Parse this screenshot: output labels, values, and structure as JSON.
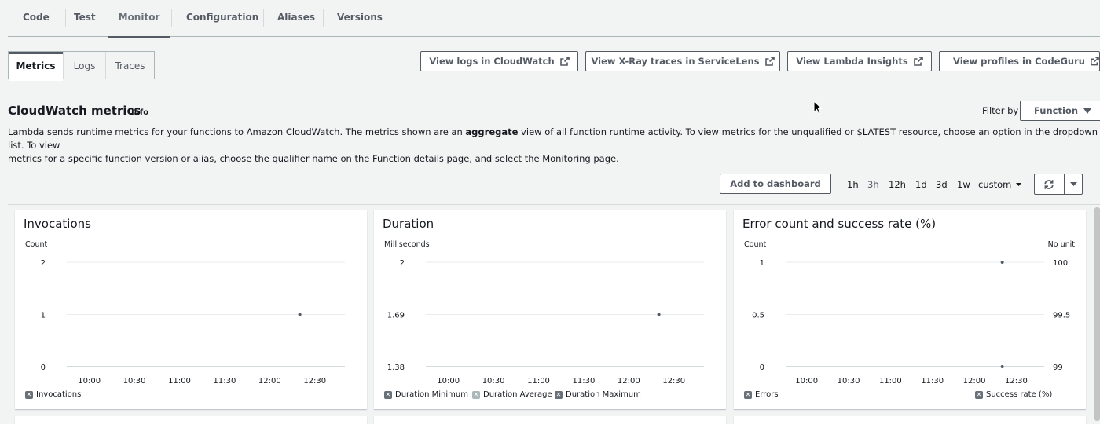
{
  "top_tabs": [
    "Code",
    "Test",
    "Monitor",
    "Configuration",
    "Aliases",
    "Versions"
  ],
  "active_top_tab": "Monitor",
  "sub_tabs": [
    "Metrics",
    "Logs",
    "Traces"
  ],
  "active_sub_tab": "Metrics",
  "action_buttons": [
    "View logs in CloudWatch",
    "View X-Ray traces in ServiceLens",
    "View Lambda Insights",
    "View profiles in CodeGuru"
  ],
  "section": {
    "title": "CloudWatch metrics",
    "info": "Info",
    "description_part1": "Lambda sends runtime metrics for your functions to Amazon CloudWatch. The metrics shown are an ",
    "description_bold": "aggregate",
    "description_part2": " view of all function runtime activity. To view metrics for the unqualified or $LATEST resource, choose an option in the dropdown list. To view",
    "description_line2": "metrics for a specific function version or alias, choose the qualifier name on the Function details page, and select the Monitoring page."
  },
  "filter": {
    "label": "Filter by",
    "value": "Function"
  },
  "toolbar": {
    "add_dashboard": "Add to dashboard",
    "time_ranges": [
      "1h",
      "3h",
      "12h",
      "1d",
      "3d",
      "1w"
    ],
    "active_time_range": "3h",
    "custom": "custom"
  },
  "chart_data": [
    {
      "type": "scatter",
      "title": "Invocations",
      "ylabel": "Count",
      "yticks": [
        "2",
        "1",
        "0"
      ],
      "ylim": [
        0,
        2
      ],
      "xticks": [
        "10:00",
        "10:30",
        "11:00",
        "11:30",
        "12:00",
        "12:30"
      ],
      "series": [
        {
          "name": "Invocations",
          "x": [
            "12:20"
          ],
          "y": [
            1
          ]
        }
      ]
    },
    {
      "type": "scatter",
      "title": "Duration",
      "ylabel": "Milliseconds",
      "yticks": [
        "2",
        "1.69",
        "1.38"
      ],
      "ylim": [
        1.38,
        2
      ],
      "xticks": [
        "10:00",
        "10:30",
        "11:00",
        "11:30",
        "12:00",
        "12:30"
      ],
      "legend": [
        "Duration Minimum",
        "Duration Average",
        "Duration Maximum"
      ],
      "series": [
        {
          "name": "Duration Average",
          "x": [
            "12:20"
          ],
          "y": [
            1.69
          ]
        }
      ]
    },
    {
      "type": "scatter",
      "title": "Error count and success rate (%)",
      "ylabel": "Count",
      "y2label": "No unit",
      "yticks": [
        "1",
        "0.5",
        "0"
      ],
      "y2ticks": [
        "100",
        "99.5",
        "99"
      ],
      "ylim": [
        0,
        1
      ],
      "y2lim": [
        99,
        100
      ],
      "xticks": [
        "10:00",
        "10:30",
        "11:00",
        "11:30",
        "12:00",
        "12:30"
      ],
      "series": [
        {
          "name": "Errors",
          "x": [
            "12:20"
          ],
          "y": [
            0
          ]
        },
        {
          "name": "Success rate (%)",
          "x": [
            "12:20"
          ],
          "y": [
            100
          ]
        }
      ]
    }
  ]
}
